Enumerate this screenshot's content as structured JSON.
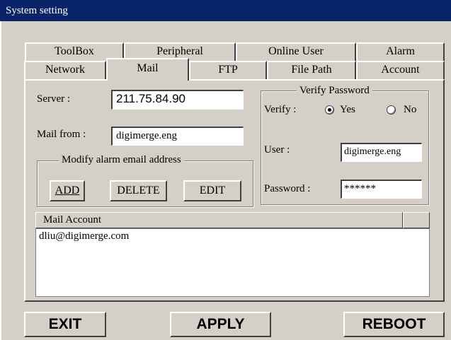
{
  "window": {
    "title": "System setting"
  },
  "tabs_back": [
    "ToolBox",
    "Peripheral",
    "Online User",
    "Alarm"
  ],
  "tabs_front": [
    "Network",
    "Mail",
    "FTP",
    "File Path",
    "Account"
  ],
  "mail": {
    "server_label": "Server :",
    "server_value": "211.75.84.90",
    "mail_from_label": "Mail from :",
    "mail_from_value": "digimerge.eng",
    "modify_group_title": "Modify alarm email address",
    "add_label": "ADD",
    "delete_label": "DELETE",
    "edit_label": "EDIT",
    "verify_group_title": "Verify Password",
    "verify_label": "Verify :",
    "verify_yes": "Yes",
    "verify_no": "No",
    "verify_selected": "Yes",
    "user_label": "User :",
    "user_value": "digimerge.eng",
    "password_label": "Password :",
    "password_value": "******",
    "list_header": "Mail Account",
    "accounts": [
      "dliu@digimerge.com"
    ]
  },
  "footer": {
    "exit_label": "EXIT",
    "apply_label": "APPLY",
    "reboot_label": "REBOOT"
  },
  "colors": {
    "title_bar": "#0a246a",
    "dialog_bg": "#d4d0c8"
  }
}
